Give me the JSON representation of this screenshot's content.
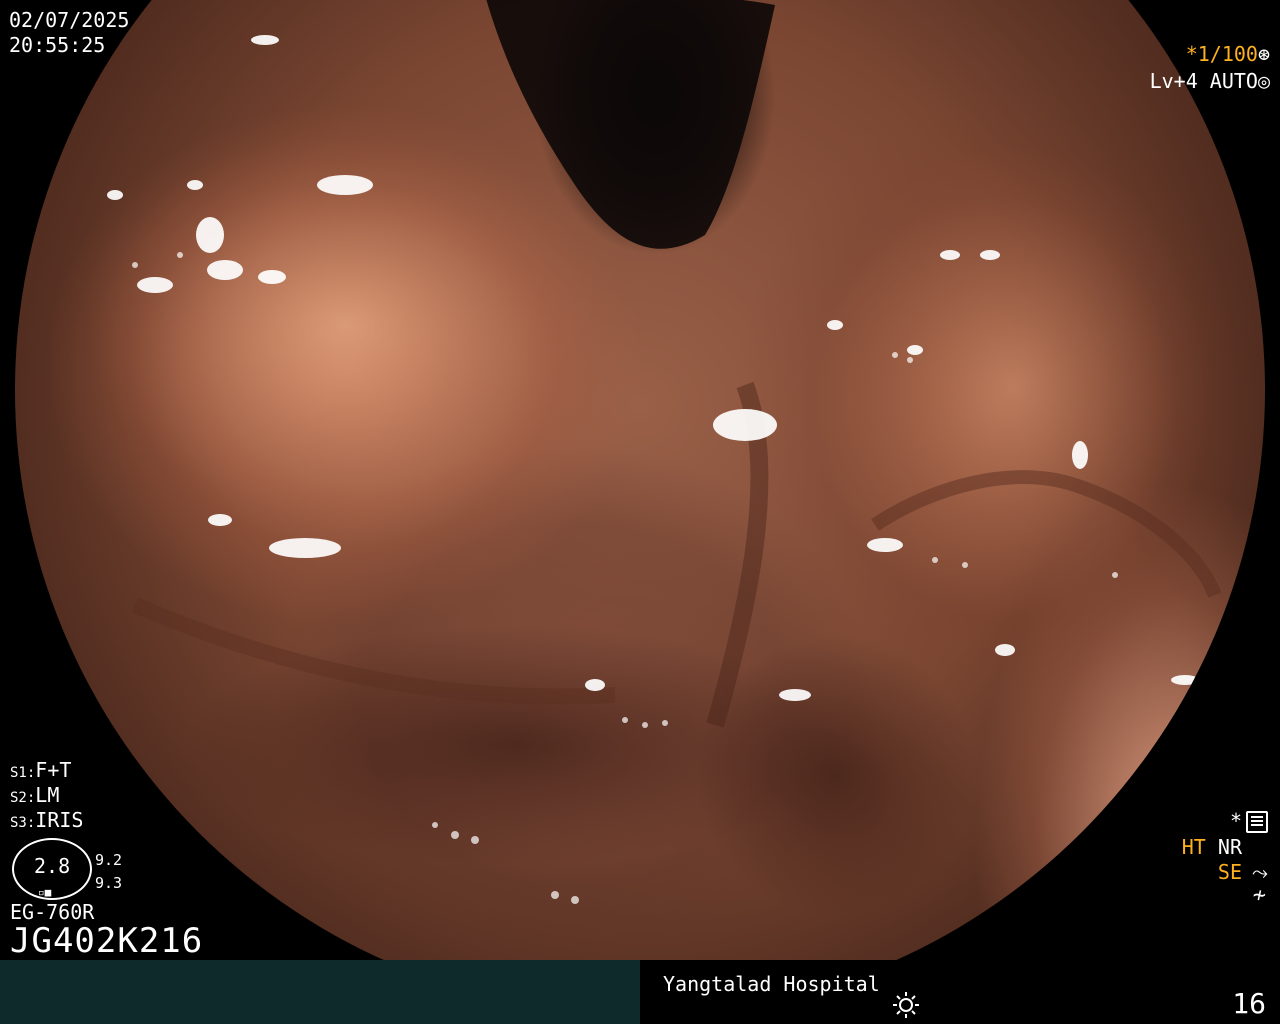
{
  "overlay": {
    "date": "02/07/2025",
    "time": "20:55:25",
    "shutter_prefix": "*1/100",
    "shutter_icon": "shutter-icon",
    "level": "Lv+4 AUTO",
    "level_icon": "iris-icon",
    "settings": [
      {
        "key": "S1:",
        "value": "F+T"
      },
      {
        "key": "S2:",
        "value": "LM"
      },
      {
        "key": "S3:",
        "value": "IRIS"
      }
    ],
    "zoom_value": "2.8",
    "zoom_a": "9.2",
    "zoom_b": "9.3",
    "scope_model": "EG-760R",
    "serial": "JG402K216",
    "star": "*",
    "ht": "HT",
    "nr": "NR",
    "se": "SE",
    "wave": "≁"
  },
  "footer": {
    "hospital": "Yangtalad Hospital",
    "page_number": "16"
  },
  "colors": {
    "accent": "#ffb020",
    "bar": "#0f2a2a"
  }
}
